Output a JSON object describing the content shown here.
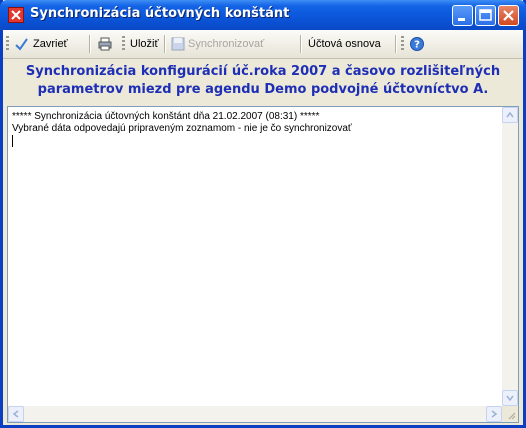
{
  "window": {
    "title": "Synchronizácia účtovných konštánt",
    "icon": "app-window-icon",
    "controls": [
      "minimize-icon",
      "maximize-icon",
      "close-icon"
    ]
  },
  "toolbar": {
    "close_label": "Zavrieť",
    "print_icon": "printer-icon",
    "save_label": "Uložiť",
    "sync_label": "Synchronizovať",
    "chart_label": "Účtová osnova",
    "help_icon": "help-icon"
  },
  "header": {
    "line1": "Synchronizácia konfigurácií úč.roka 2007 a časovo rozlišiteľných",
    "line2": "parametrov miezd  pre agendu Demo podvojné účtovníctvo A."
  },
  "log": {
    "line1": "***** Synchronizácia účtovných konštánt dňa 21.02.2007 (08:31) *****",
    "line2": "Vybrané dáta odpovedajú pripraveným zoznamom - nie je čo synchronizovať"
  },
  "colors": {
    "title_bar": "#0a49c7",
    "header_text": "#1e2fb5",
    "toolbar_bg": "#ece9d8"
  }
}
